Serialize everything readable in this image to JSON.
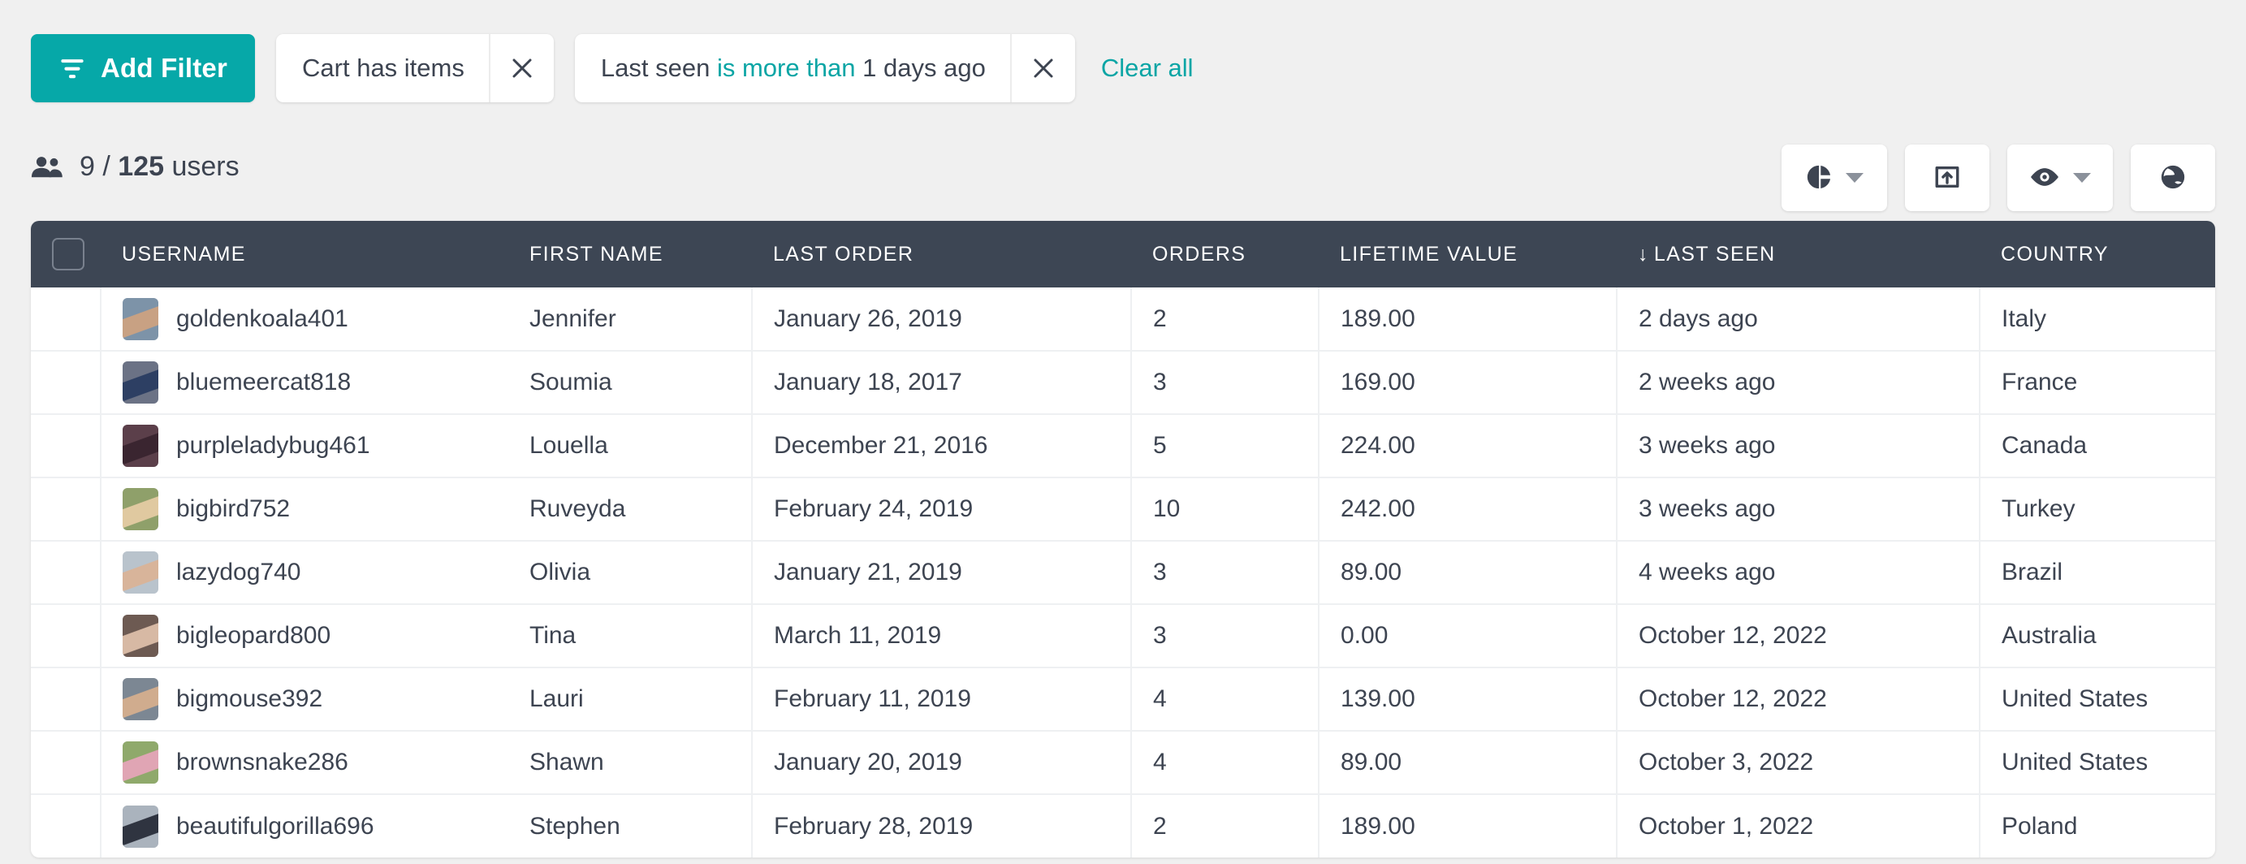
{
  "colors": {
    "accent_teal": "#06a8a8",
    "link_teal": "#0aa5a5",
    "header_dark": "#3d4654",
    "text_dark": "#3d4451",
    "page_bg": "#f0f0f0"
  },
  "filter_bar": {
    "add_filter_label": "Add Filter",
    "filter_icon": "funnel-icon",
    "chips": [
      {
        "field": "Cart",
        "operator": "has items",
        "value": "",
        "operator_highlighted": false,
        "remove_icon": "close-icon"
      },
      {
        "field": "Last seen",
        "operator": "is more than",
        "value": "1 days ago",
        "operator_highlighted": true,
        "remove_icon": "close-icon"
      }
    ],
    "clear_all_label": "Clear all"
  },
  "summary": {
    "icon": "people-icon",
    "shown_count": "9",
    "separator": "/",
    "total_count": "125",
    "unit_label": "users"
  },
  "toolbar": {
    "buttons": [
      {
        "name": "chart-button",
        "icon": "pie-chart-icon",
        "has_caret": true
      },
      {
        "name": "export-button",
        "icon": "export-icon",
        "has_caret": false
      },
      {
        "name": "visibility-button",
        "icon": "eye-icon",
        "has_caret": true
      },
      {
        "name": "globe-button",
        "icon": "globe-icon",
        "has_caret": false
      }
    ]
  },
  "table": {
    "select_all_checkbox": {
      "checked": false
    },
    "sort": {
      "column": "LAST SEEN",
      "direction": "desc",
      "arrow": "↓"
    },
    "columns": [
      {
        "key": "username",
        "label": "USERNAME"
      },
      {
        "key": "first_name",
        "label": "FIRST NAME"
      },
      {
        "key": "last_order",
        "label": "LAST ORDER"
      },
      {
        "key": "orders",
        "label": "ORDERS"
      },
      {
        "key": "lifetime_value",
        "label": "LIFETIME VALUE"
      },
      {
        "key": "last_seen",
        "label": "LAST SEEN"
      },
      {
        "key": "country",
        "label": "COUNTRY"
      }
    ],
    "rows": [
      {
        "username": "goldenkoala401",
        "first_name": "Jennifer",
        "last_order": "January 26, 2019",
        "orders": "2",
        "lifetime_value": "189.00",
        "last_seen": "2 days ago",
        "country": "Italy",
        "avatar_colors": [
          "#7d93a8",
          "#c8a183"
        ]
      },
      {
        "username": "bluemeercat818",
        "first_name": "Soumia",
        "last_order": "January 18, 2017",
        "orders": "3",
        "lifetime_value": "169.00",
        "last_seen": "2 weeks ago",
        "country": "France",
        "avatar_colors": [
          "#6b7285",
          "#2d3f63"
        ]
      },
      {
        "username": "purpleladybug461",
        "first_name": "Louella",
        "last_order": "December 21, 2016",
        "orders": "5",
        "lifetime_value": "224.00",
        "last_seen": "3 weeks ago",
        "country": "Canada",
        "avatar_colors": [
          "#5b3f4a",
          "#3a2530"
        ]
      },
      {
        "username": "bigbird752",
        "first_name": "Ruveyda",
        "last_order": "February 24, 2019",
        "orders": "10",
        "lifetime_value": "242.00",
        "last_seen": "3 weeks ago",
        "country": "Turkey",
        "avatar_colors": [
          "#8fa06a",
          "#e0c9a0"
        ]
      },
      {
        "username": "lazydog740",
        "first_name": "Olivia",
        "last_order": "January 21, 2019",
        "orders": "3",
        "lifetime_value": "89.00",
        "last_seen": "4 weeks ago",
        "country": "Brazil",
        "avatar_colors": [
          "#b9c3cc",
          "#d8b49a"
        ]
      },
      {
        "username": "bigleopard800",
        "first_name": "Tina",
        "last_order": "March 11, 2019",
        "orders": "3",
        "lifetime_value": "0.00",
        "last_seen": "October 12, 2022",
        "country": "Australia",
        "avatar_colors": [
          "#6d5a52",
          "#d7b9a4"
        ]
      },
      {
        "username": "bigmouse392",
        "first_name": "Lauri",
        "last_order": "February 11, 2019",
        "orders": "4",
        "lifetime_value": "139.00",
        "last_seen": "October 12, 2022",
        "country": "United States",
        "avatar_colors": [
          "#7c8793",
          "#d0ac8e"
        ]
      },
      {
        "username": "brownsnake286",
        "first_name": "Shawn",
        "last_order": "January 20, 2019",
        "orders": "4",
        "lifetime_value": "89.00",
        "last_seen": "October 3, 2022",
        "country": "United States",
        "avatar_colors": [
          "#8fa96b",
          "#e0a5b4"
        ]
      },
      {
        "username": "beautifulgorilla696",
        "first_name": "Stephen",
        "last_order": "February 28, 2019",
        "orders": "2",
        "lifetime_value": "189.00",
        "last_seen": "October 1, 2022",
        "country": "Poland",
        "avatar_colors": [
          "#aab3bd",
          "#2f3440"
        ]
      }
    ]
  }
}
